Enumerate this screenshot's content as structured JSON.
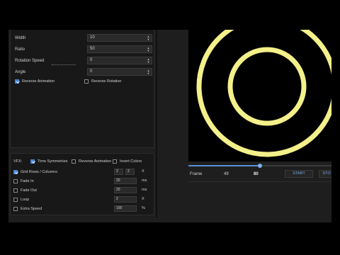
{
  "params": {
    "width": {
      "label": "Width",
      "value": "10"
    },
    "ratio": {
      "label": "Ratio",
      "value": "50"
    },
    "rotation_speed": {
      "label": "Rotation Speed",
      "value": "0"
    },
    "angle": {
      "label": "Angle",
      "value": "0"
    },
    "reverse_animation": {
      "label": "Reverse Animation",
      "checked": true
    },
    "reverse_rotation": {
      "label": "Reverse Rotation",
      "checked": false
    }
  },
  "vfx": {
    "label": "VFX:",
    "time_symmetrize": {
      "label": "Time Symmetrize",
      "checked": true
    },
    "reverse_animation": {
      "label": "Reverse Animation",
      "checked": false
    },
    "invert_colors": {
      "label": "Invert Colors",
      "checked": false
    },
    "grid": {
      "label": "Grid Rows / Columns",
      "checked": true,
      "rows": "2",
      "cols": "2",
      "unit": "X"
    },
    "fade_in": {
      "label": "Fade In",
      "checked": false,
      "value": "20",
      "unit": "ms"
    },
    "fade_out": {
      "label": "Fade Out",
      "checked": false,
      "value": "20",
      "unit": "ms"
    },
    "loop": {
      "label": "Loop",
      "checked": false,
      "value": "2",
      "unit": "X"
    },
    "extra_speed": {
      "label": "Extra Speed",
      "checked": false,
      "value": "100",
      "unit": "%"
    }
  },
  "playback": {
    "frame_label": "Frame",
    "current_frame": "49",
    "total_frames": "80",
    "progress_fraction": 0.5,
    "start_label": "START",
    "stop_label": "STO"
  },
  "colors": {
    "ring": "#f4f08a",
    "accent": "#4a86d8",
    "button_text": "#7fa9e6"
  }
}
